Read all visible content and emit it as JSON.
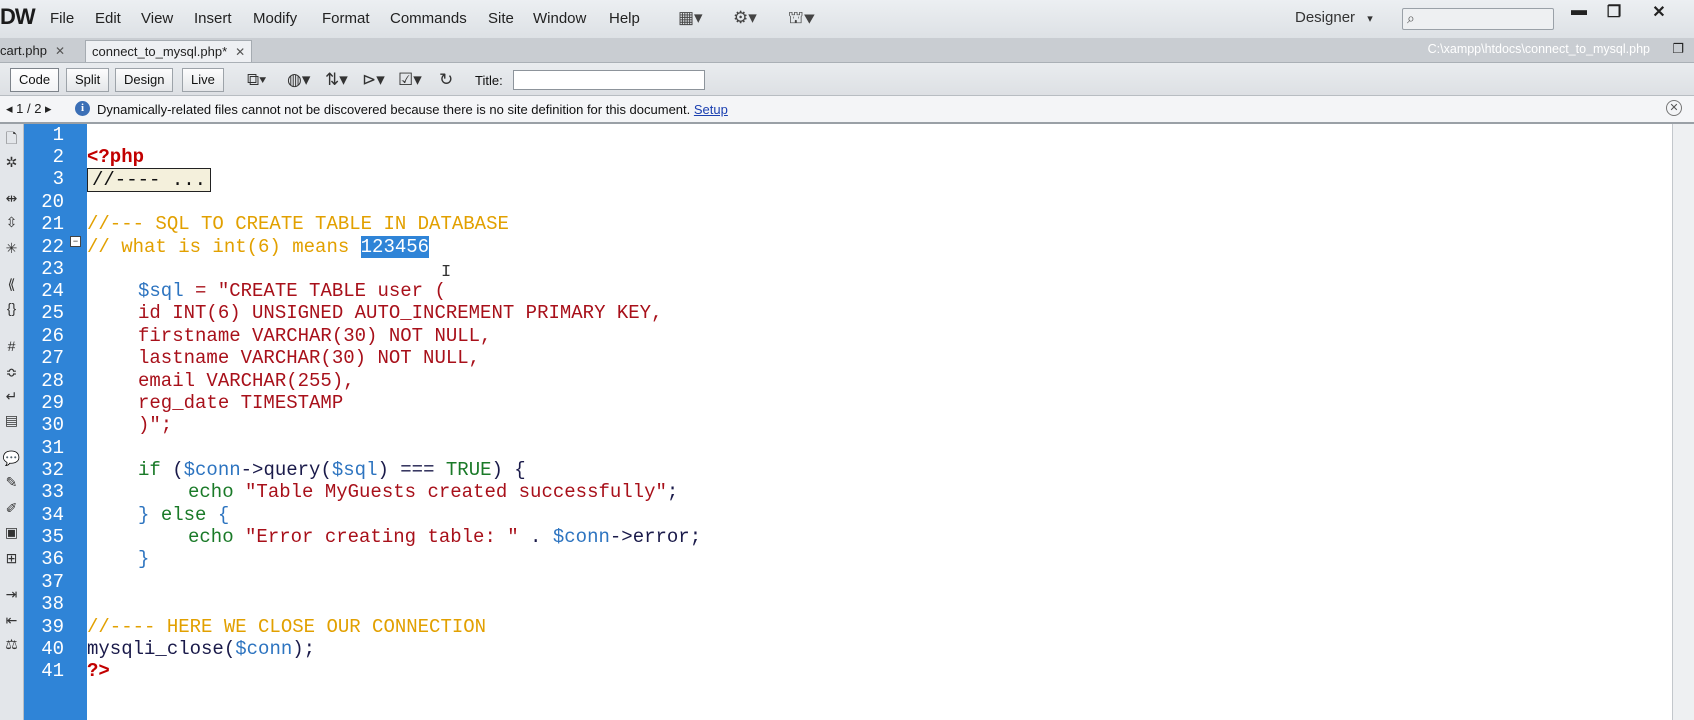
{
  "app": {
    "logo": "DW"
  },
  "menu": [
    "File",
    "Edit",
    "View",
    "Insert",
    "Modify",
    "Format",
    "Commands",
    "Site",
    "Window",
    "Help"
  ],
  "menu_icons": [
    "layout-icon",
    "gear-icon",
    "site-icon"
  ],
  "workspace": {
    "label": "Designer",
    "caret": "▾"
  },
  "search": {
    "placeholder": "",
    "icon": "search-icon"
  },
  "window_controls": {
    "minimize": "▬",
    "maximize": "❐",
    "close": "✕"
  },
  "tabs": [
    {
      "label": "cart.php",
      "close": "✕"
    },
    {
      "label": "connect_to_mysql.php*",
      "close": "✕"
    }
  ],
  "file_path": "C:\\xampp\\htdocs\\connect_to_mysql.php",
  "doc_toolbar": {
    "views": [
      "Code",
      "Split",
      "Design",
      "Live"
    ],
    "title_label": "Title:",
    "title_value": ""
  },
  "infobar": {
    "pager": "◂ 1 / 2 ▸",
    "message": "Dynamically-related files cannot not be discovered because there is no site definition for this document. ",
    "link": "Setup"
  },
  "code": {
    "line_numbers": [
      "1",
      "2",
      "3",
      "20",
      "21",
      "22",
      "23",
      "24",
      "25",
      "26",
      "27",
      "28",
      "29",
      "30",
      "31",
      "32",
      "33",
      "34",
      "35",
      "36",
      "37",
      "38",
      "39",
      "40",
      "41"
    ],
    "php_open": "<?php",
    "folded": "//---- ...",
    "l21": "//--- SQL TO CREATE TABLE IN DATABASE",
    "l22_a": "// what is int(6) means ",
    "l22_sel": "123456",
    "l24_var": "$sql",
    "l24_eq": " = ",
    "l24_str": "\"CREATE TABLE user (",
    "l25": "id INT(6) UNSIGNED AUTO_INCREMENT PRIMARY KEY,",
    "l26": "firstname VARCHAR(30) NOT NULL,",
    "l27": "lastname VARCHAR(30) NOT NULL,",
    "l28": "email VARCHAR(255),",
    "l29": "reg_date TIMESTAMP",
    "l30": ")\";",
    "l32_if": "if",
    "l32_p1": " (",
    "l32_conn": "$conn",
    "l32_arrow": "->query(",
    "l32_sql": "$sql",
    "l32_rest": ") === ",
    "l32_true": "TRUE",
    "l32_end": ") {",
    "l33_echo": "echo",
    "l33_str": " \"Table MyGuests created successfully\"",
    "l33_end": ";",
    "l34_a": "} ",
    "l34_else": "else",
    "l34_b": " {",
    "l35_echo": "echo",
    "l35_str": " \"Error creating table: \"",
    "l35_dot": " . ",
    "l35_conn": "$conn",
    "l35_rest": "->error;",
    "l36": "}",
    "l39": "//---- HERE WE CLOSE OUR CONNECTION",
    "l40_fn": "mysqli_close(",
    "l40_conn": "$conn",
    "l40_end": ");",
    "l41": "?>"
  },
  "colors": {
    "gutter": "#2f84d7",
    "comment": "#e2a000",
    "string": "#a8101a",
    "variable": "#2d74c0",
    "keyword": "#1a7a28"
  }
}
